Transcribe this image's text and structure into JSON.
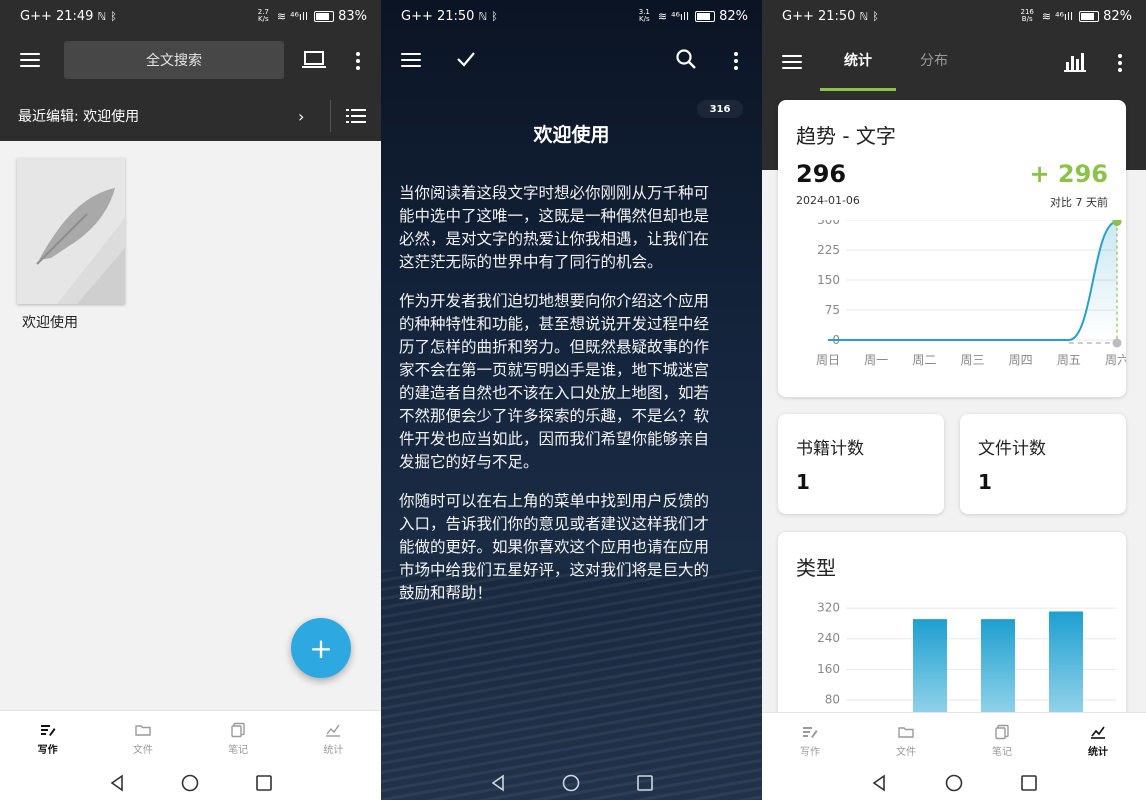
{
  "panel1": {
    "status": {
      "time": "G++ 21:49",
      "net_speed_top": "2.7",
      "net_speed_bottom": "K/s",
      "signal": "⁴⁶ıll",
      "battery": "83%"
    },
    "toolbar": {
      "search_label": "全文搜索"
    },
    "recent": {
      "label": "最近编辑: 欢迎使用",
      "chevron": "›"
    },
    "book": {
      "title": "欢迎使用"
    },
    "fab_label": "+",
    "nav": [
      {
        "label": "写作",
        "icon": "pen-icon",
        "active": true
      },
      {
        "label": "文件",
        "icon": "folder-icon",
        "active": false
      },
      {
        "label": "笔记",
        "icon": "notes-icon",
        "active": false
      },
      {
        "label": "统计",
        "icon": "stats-icon",
        "active": false
      }
    ]
  },
  "panel2": {
    "status": {
      "time": "G++ 21:50",
      "net_speed_top": "3.1",
      "net_speed_bottom": "K/s",
      "signal": "⁴⁶ıll",
      "battery": "82%"
    },
    "word_count": "316",
    "title": "欢迎使用",
    "paragraphs": [
      [
        "当你阅读着这段文字时想必你刚刚从万千种可",
        "能中选中了这唯一，这既是一种偶然但却也是",
        "必然，是对文字的热爱让你我相遇，让我们在",
        "这茫茫无际的世界中有了同行的机会。"
      ],
      [
        "作为开发者我们迫切地想要向你介绍这个应用",
        "的种种特性和功能，甚至想说说开发过程中经",
        "历了怎样的曲折和努力。但既然悬疑故事的作",
        "家不会在第一页就写明凶手是谁，地下城迷宫",
        "的建造者自然也不该在入口处放上地图，如若",
        "不然那便会少了许多探索的乐趣，不是么？软",
        "件开发也应当如此，因而我们希望你能够亲自",
        "发掘它的好与不足。"
      ],
      [
        "你随时可以在右上角的菜单中找到用户反馈的",
        "入口，告诉我们你的意见或者建议这样我们才",
        "能做的更好。如果你喜欢这个应用也请在应用",
        "市场中给我们五星好评，这对我们将是巨大的",
        "鼓励和帮助！"
      ]
    ]
  },
  "panel3": {
    "status": {
      "time": "G++ 21:50",
      "net_speed_top": "216",
      "net_speed_bottom": "B/s",
      "signal": "⁴⁶ıll",
      "battery": "82%"
    },
    "tabs": [
      "统计",
      "分布"
    ],
    "trend": {
      "title": "趋势 - 文字",
      "value": "296",
      "date": "2024-01-06",
      "delta": "+ 296",
      "delta_caption": "对比 7 天前"
    },
    "book_count": {
      "label": "书籍计数",
      "value": "1"
    },
    "file_count": {
      "label": "文件计数",
      "value": "1"
    },
    "type_card": {
      "title": "类型"
    },
    "nav": [
      {
        "label": "写作",
        "icon": "pen-icon",
        "active": false
      },
      {
        "label": "文件",
        "icon": "folder-icon",
        "active": false
      },
      {
        "label": "笔记",
        "icon": "notes-icon",
        "active": false
      },
      {
        "label": "统计",
        "icon": "stats-icon",
        "active": true
      }
    ]
  },
  "chart_data": [
    {
      "type": "area",
      "title": "趋势 - 文字",
      "categories": [
        "周日",
        "周一",
        "周二",
        "周三",
        "周四",
        "周五",
        "周六"
      ],
      "values": [
        0,
        0,
        0,
        0,
        0,
        0,
        296
      ],
      "yticks": [
        0,
        75,
        150,
        225,
        300
      ],
      "ylim": [
        0,
        300
      ],
      "grid": true,
      "color": "#2aa0c8",
      "highlight_color": "#8bc34a"
    },
    {
      "type": "bar",
      "title": "类型",
      "categories": [
        "",
        "",
        ""
      ],
      "values": [
        290,
        290,
        310
      ],
      "yticks": [
        80,
        160,
        240,
        320
      ],
      "ylim": [
        0,
        340
      ],
      "grid": true,
      "color": "#1e9fd0"
    }
  ],
  "colors": {
    "accent": "#2ea8e0",
    "green": "#8bc34a",
    "toolbar": "#2d2d2d"
  }
}
